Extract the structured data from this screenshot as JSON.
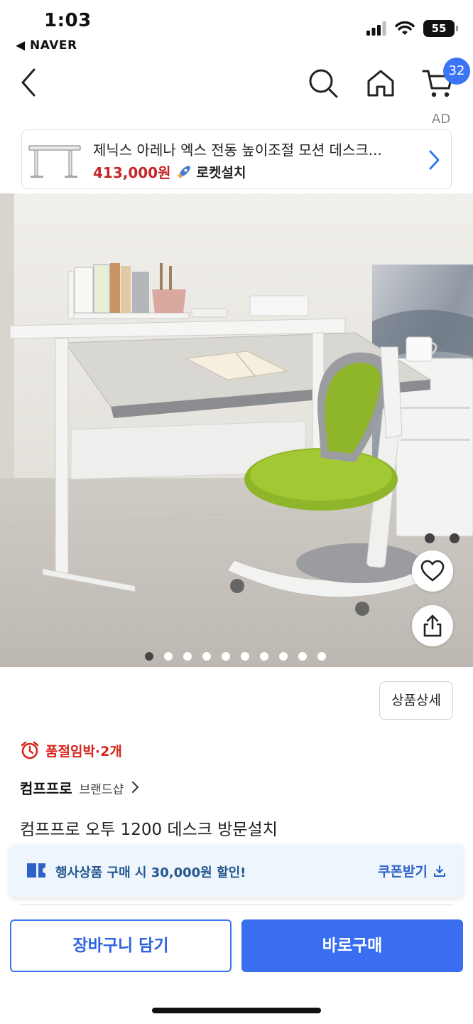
{
  "status_bar": {
    "time": "1:03",
    "back_app": "◀ NAVER",
    "battery": "55",
    "icons": [
      "signal-icon",
      "wifi-icon",
      "battery-icon"
    ]
  },
  "nav": {
    "icons": [
      "back-chevron-icon",
      "search-icon",
      "home-icon",
      "cart-icon"
    ],
    "cart_count": "32"
  },
  "ad": {
    "label": "AD",
    "title": "제닉스 아레나 엑스 전동 높이조절 모션 데스크...",
    "price": "413,000원",
    "badge": "로켓설치",
    "badge_icon": "rocket-icon"
  },
  "hero": {
    "image": "study-desk-with-green-chair-photo",
    "slide_count": 10,
    "active_slide": 1,
    "icons": [
      "heart-icon",
      "share-icon"
    ]
  },
  "detail": {
    "detail_button": "상품상세",
    "stock_icon": "alarm-clock-icon",
    "stock_text": "품절임박·2개",
    "brand_name": "컴프프로",
    "brand_shop": "브랜드샵",
    "product_title": "컴프프로 오투 1200 데스크 방문설치"
  },
  "coupon": {
    "text": "행사상품 구매 시 30,000원 할인!",
    "action": "쿠폰받기",
    "icons": [
      "coupon-icon",
      "download-icon"
    ]
  },
  "actions": {
    "cart_button": "장바구니 담기",
    "buy_button": "바로구매"
  },
  "colors": {
    "accent": "#3a6ef0",
    "price_red": "#c4262b",
    "stock_red": "#d7261c",
    "coupon_bg": "#eef5fc"
  }
}
